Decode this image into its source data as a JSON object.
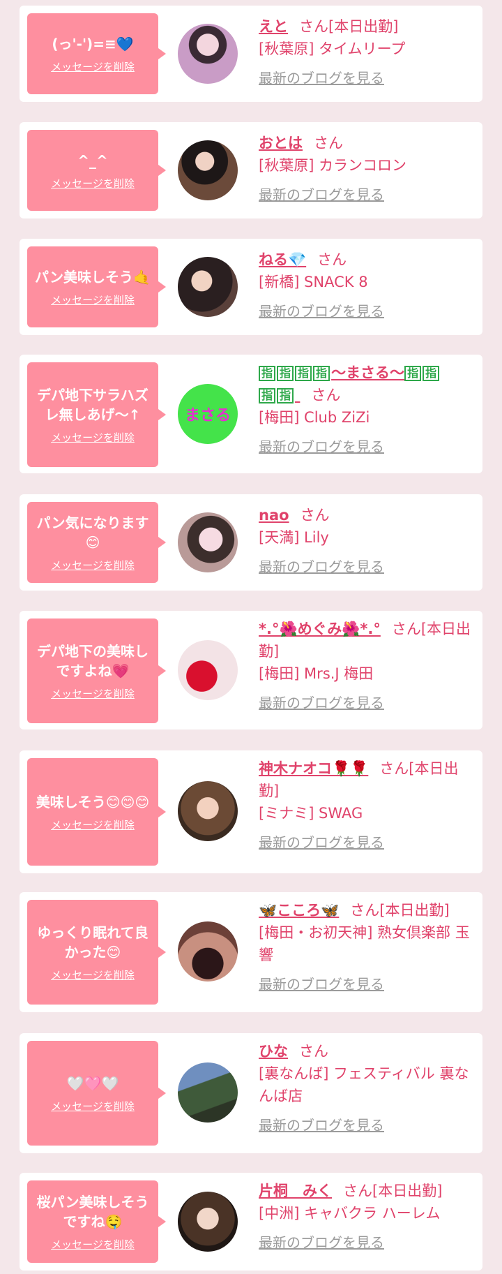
{
  "blog_link_label": "最新のブログを見る",
  "delete_label": "メッセージを削除",
  "san_suffix": "さん",
  "cards": [
    {
      "message": "(っ'-')=≡💙",
      "name": "えと",
      "suffix": "さん[本日出勤]",
      "shop": "[秋葉原] タイムリープ",
      "avatar": "photo-1"
    },
    {
      "message": "^_^",
      "name": "おとは",
      "suffix": "さん",
      "shop": "[秋葉原] カランコロン",
      "avatar": "photo-2"
    },
    {
      "message": "パン美味しそう🤙",
      "name": "ねる💎",
      "suffix": "さん",
      "shop": "[新橋] SNACK 8",
      "avatar": "photo-3"
    },
    {
      "message": "デパ地下サラハズレ無しあげ〜↑",
      "name_tags": [
        "指",
        "指",
        "指",
        "指"
      ],
      "name": "〜まさる〜",
      "name_tags_after": [
        "指",
        "指"
      ],
      "name_tags_line2": [
        "指",
        "指"
      ],
      "suffix": "さん",
      "shop": "[梅田] Club ZiZi",
      "avatar": "masaru-logo",
      "avatar_text": "まさる"
    },
    {
      "message": "パン気になります😊",
      "name": "nao",
      "suffix": "さん",
      "shop": "[天満] Lily",
      "avatar": "photo-5"
    },
    {
      "message": "デパ地下の美味しですよね💗",
      "name": "*.°🌺めぐみ🌺*.°",
      "suffix": "さん[本日出勤]",
      "shop": "[梅田] Mrs.J 梅田",
      "avatar": "heart-photo"
    },
    {
      "message": "美味しそう😊😊😊",
      "name": "神木ナオコ🌹🌹",
      "suffix": "さん[本日出勤]",
      "shop": "[ミナミ] SWAG",
      "avatar": "photo-7"
    },
    {
      "message": "ゆっくり眠れて良かった😊",
      "name": "🦋こころ🦋",
      "suffix": "さん[本日出勤]",
      "shop": "[梅田・お初天神] 熟女倶楽部 玉響",
      "avatar": "photo-8"
    },
    {
      "message": "🤍🩷🤍",
      "name": "ひな",
      "suffix": "さん",
      "shop": "[裏なんば] フェスティバル 裏なんば店",
      "avatar": "photo-9"
    },
    {
      "message": "桜パン美味しそうですね🤤",
      "name": "片桐　みく",
      "suffix": "さん[本日出勤]",
      "shop": "[中洲] キャバクラ ハーレム",
      "avatar": "photo-10"
    }
  ],
  "colors": {
    "accent": "#e0436b",
    "bubble": "#fe8f9f",
    "background": "#f4e7ea",
    "muted": "#9b9b9b",
    "tag_green": "#2ea84a"
  }
}
